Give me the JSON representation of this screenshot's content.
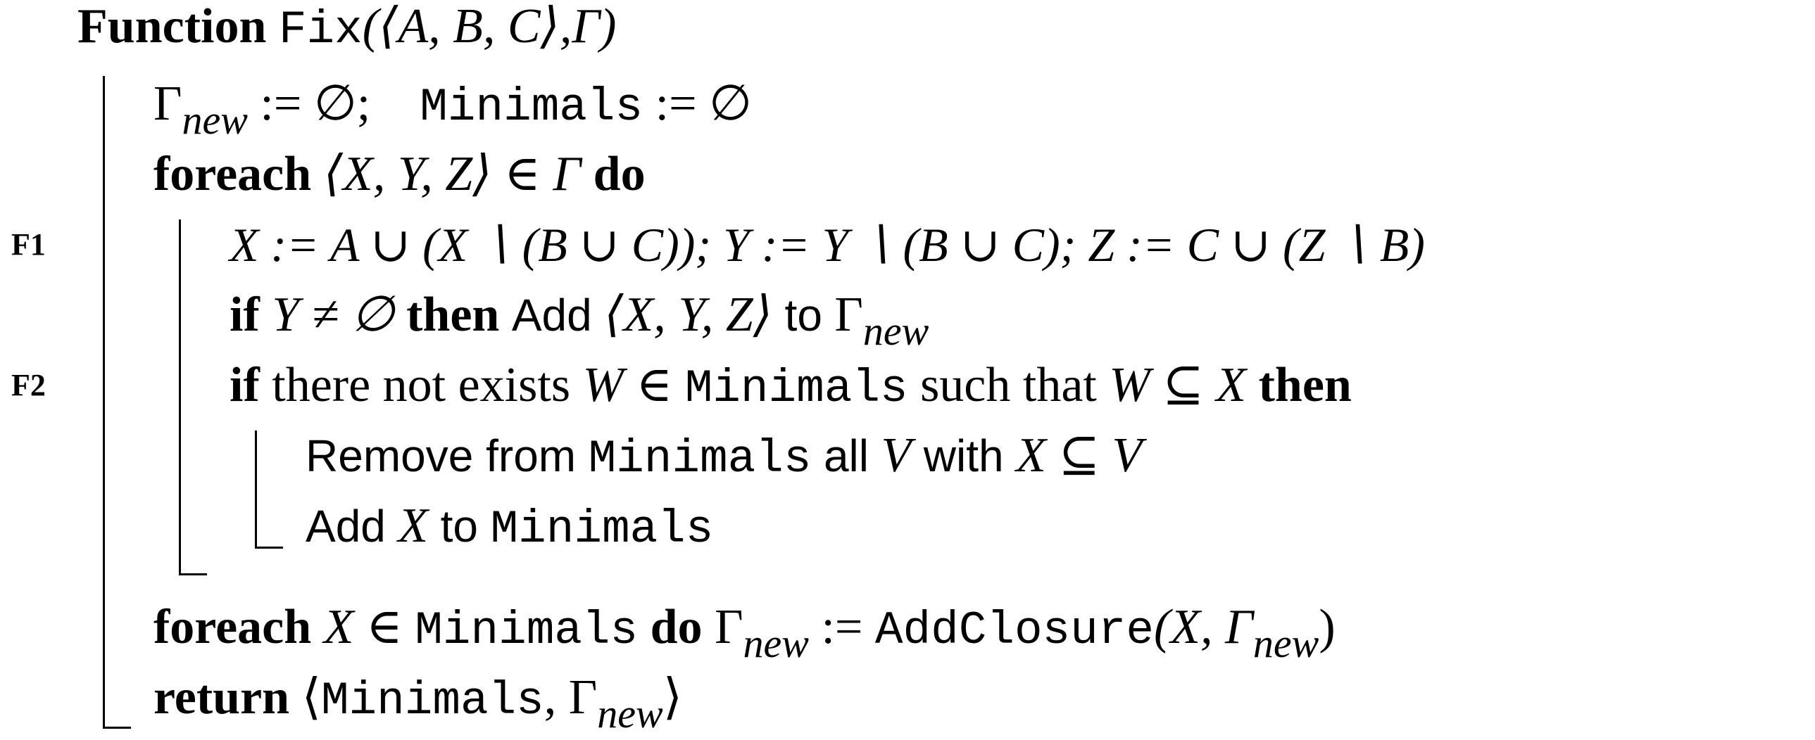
{
  "algorithm": {
    "header": {
      "keyword": "Function",
      "name": "Fix",
      "args": "(⟨A, B, C⟩,Γ)"
    },
    "labels": {
      "f1": "F1",
      "f2": "F2"
    },
    "lines": {
      "init": {
        "gamma": "Γ",
        "gamma_sub": "new",
        "assign1": " := ∅;",
        "minimals": "Minimals",
        "assign2": " := ∅"
      },
      "foreach1": {
        "keyword": "foreach",
        "expr": "⟨X, Y, Z⟩ ∈ Γ",
        "do": "do"
      },
      "f1_stmt": {
        "text": "X := A ∪ (X ∖ (B ∪ C));     Y := Y ∖ (B ∪ C);     Z := C ∪ (Z ∖ B)"
      },
      "if1": {
        "keyword": "if",
        "cond": "Y ≠ ∅",
        "then": "then",
        "action": "Add",
        "expr": "⟨X, Y, Z⟩",
        "to": "to",
        "gamma": "Γ",
        "gamma_sub": "new"
      },
      "if2": {
        "keyword": "if",
        "text1": "there not exists",
        "var_w": "W ∈",
        "minimals": "Minimals",
        "text2": "such that",
        "cond": "W ⊆ X",
        "then": "then"
      },
      "remove": {
        "text1": "Remove from",
        "minimals": "Minimals",
        "text2": "all",
        "var_v": "V",
        "text3": "with",
        "cond": "X ⊆ V"
      },
      "add": {
        "text1": "Add",
        "var_x": "X",
        "text2": "to",
        "minimals": "Minimals"
      },
      "foreach2": {
        "keyword": "foreach",
        "expr": "X ∈",
        "minimals": "Minimals",
        "do": "do",
        "gamma": "Γ",
        "gamma_sub": "new",
        "assign": " := ",
        "call": "AddClosure",
        "args_open": "(X, Γ",
        "args_sub": "new",
        "args_close": ")"
      },
      "return": {
        "keyword": "return",
        "open": "⟨",
        "minimals": "Minimals",
        "comma": ", Γ",
        "sub": "new",
        "close": "⟩"
      }
    }
  }
}
